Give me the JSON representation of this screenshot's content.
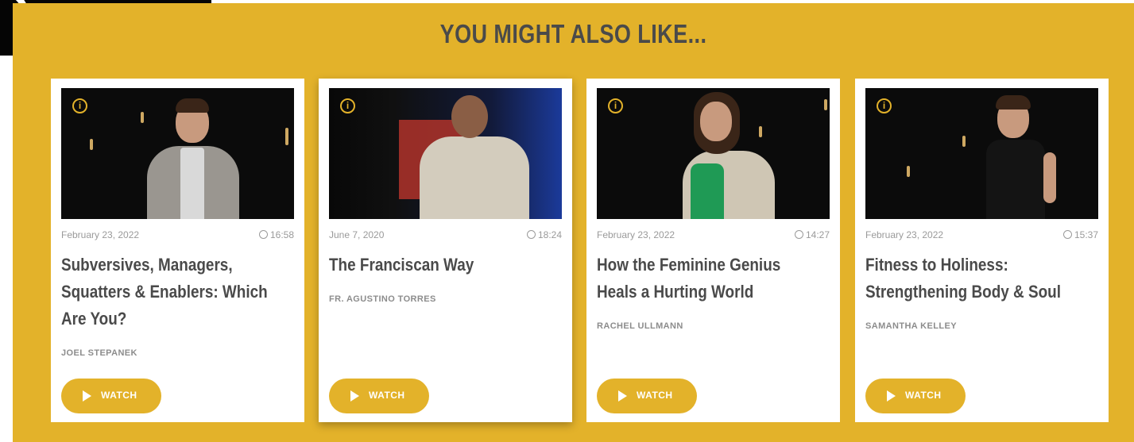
{
  "section": {
    "heading": "YOU MIGHT ALSO LIKE..."
  },
  "colors": {
    "accent": "#e3b22a",
    "heading": "#4a4a4a",
    "meta": "#9a9a9a"
  },
  "icons": {
    "info": "info-icon",
    "clock": "clock-icon",
    "play": "play-icon"
  },
  "cards": [
    {
      "date": "February 23, 2022",
      "duration": "16:58",
      "title_lines": [
        "Subversives, Managers,",
        "Squatters & Enablers: Which",
        "Are You?"
      ],
      "speaker": "JOEL STEPANEK",
      "watch": "WATCH"
    },
    {
      "date": "June 7, 2020",
      "duration": "18:24",
      "title_lines": [
        "The Franciscan Way"
      ],
      "speaker": "FR. AGUSTINO TORRES",
      "watch": "WATCH"
    },
    {
      "date": "February 23, 2022",
      "duration": "14:27",
      "title_lines": [
        "How the Feminine Genius",
        "Heals a Hurting World"
      ],
      "speaker": "RACHEL ULLMANN",
      "watch": "WATCH"
    },
    {
      "date": "February 23, 2022",
      "duration": "15:37",
      "title_lines": [
        "Fitness to Holiness:",
        "Strengthening Body & Soul"
      ],
      "speaker": "SAMANTHA KELLEY",
      "watch": "WATCH"
    }
  ]
}
